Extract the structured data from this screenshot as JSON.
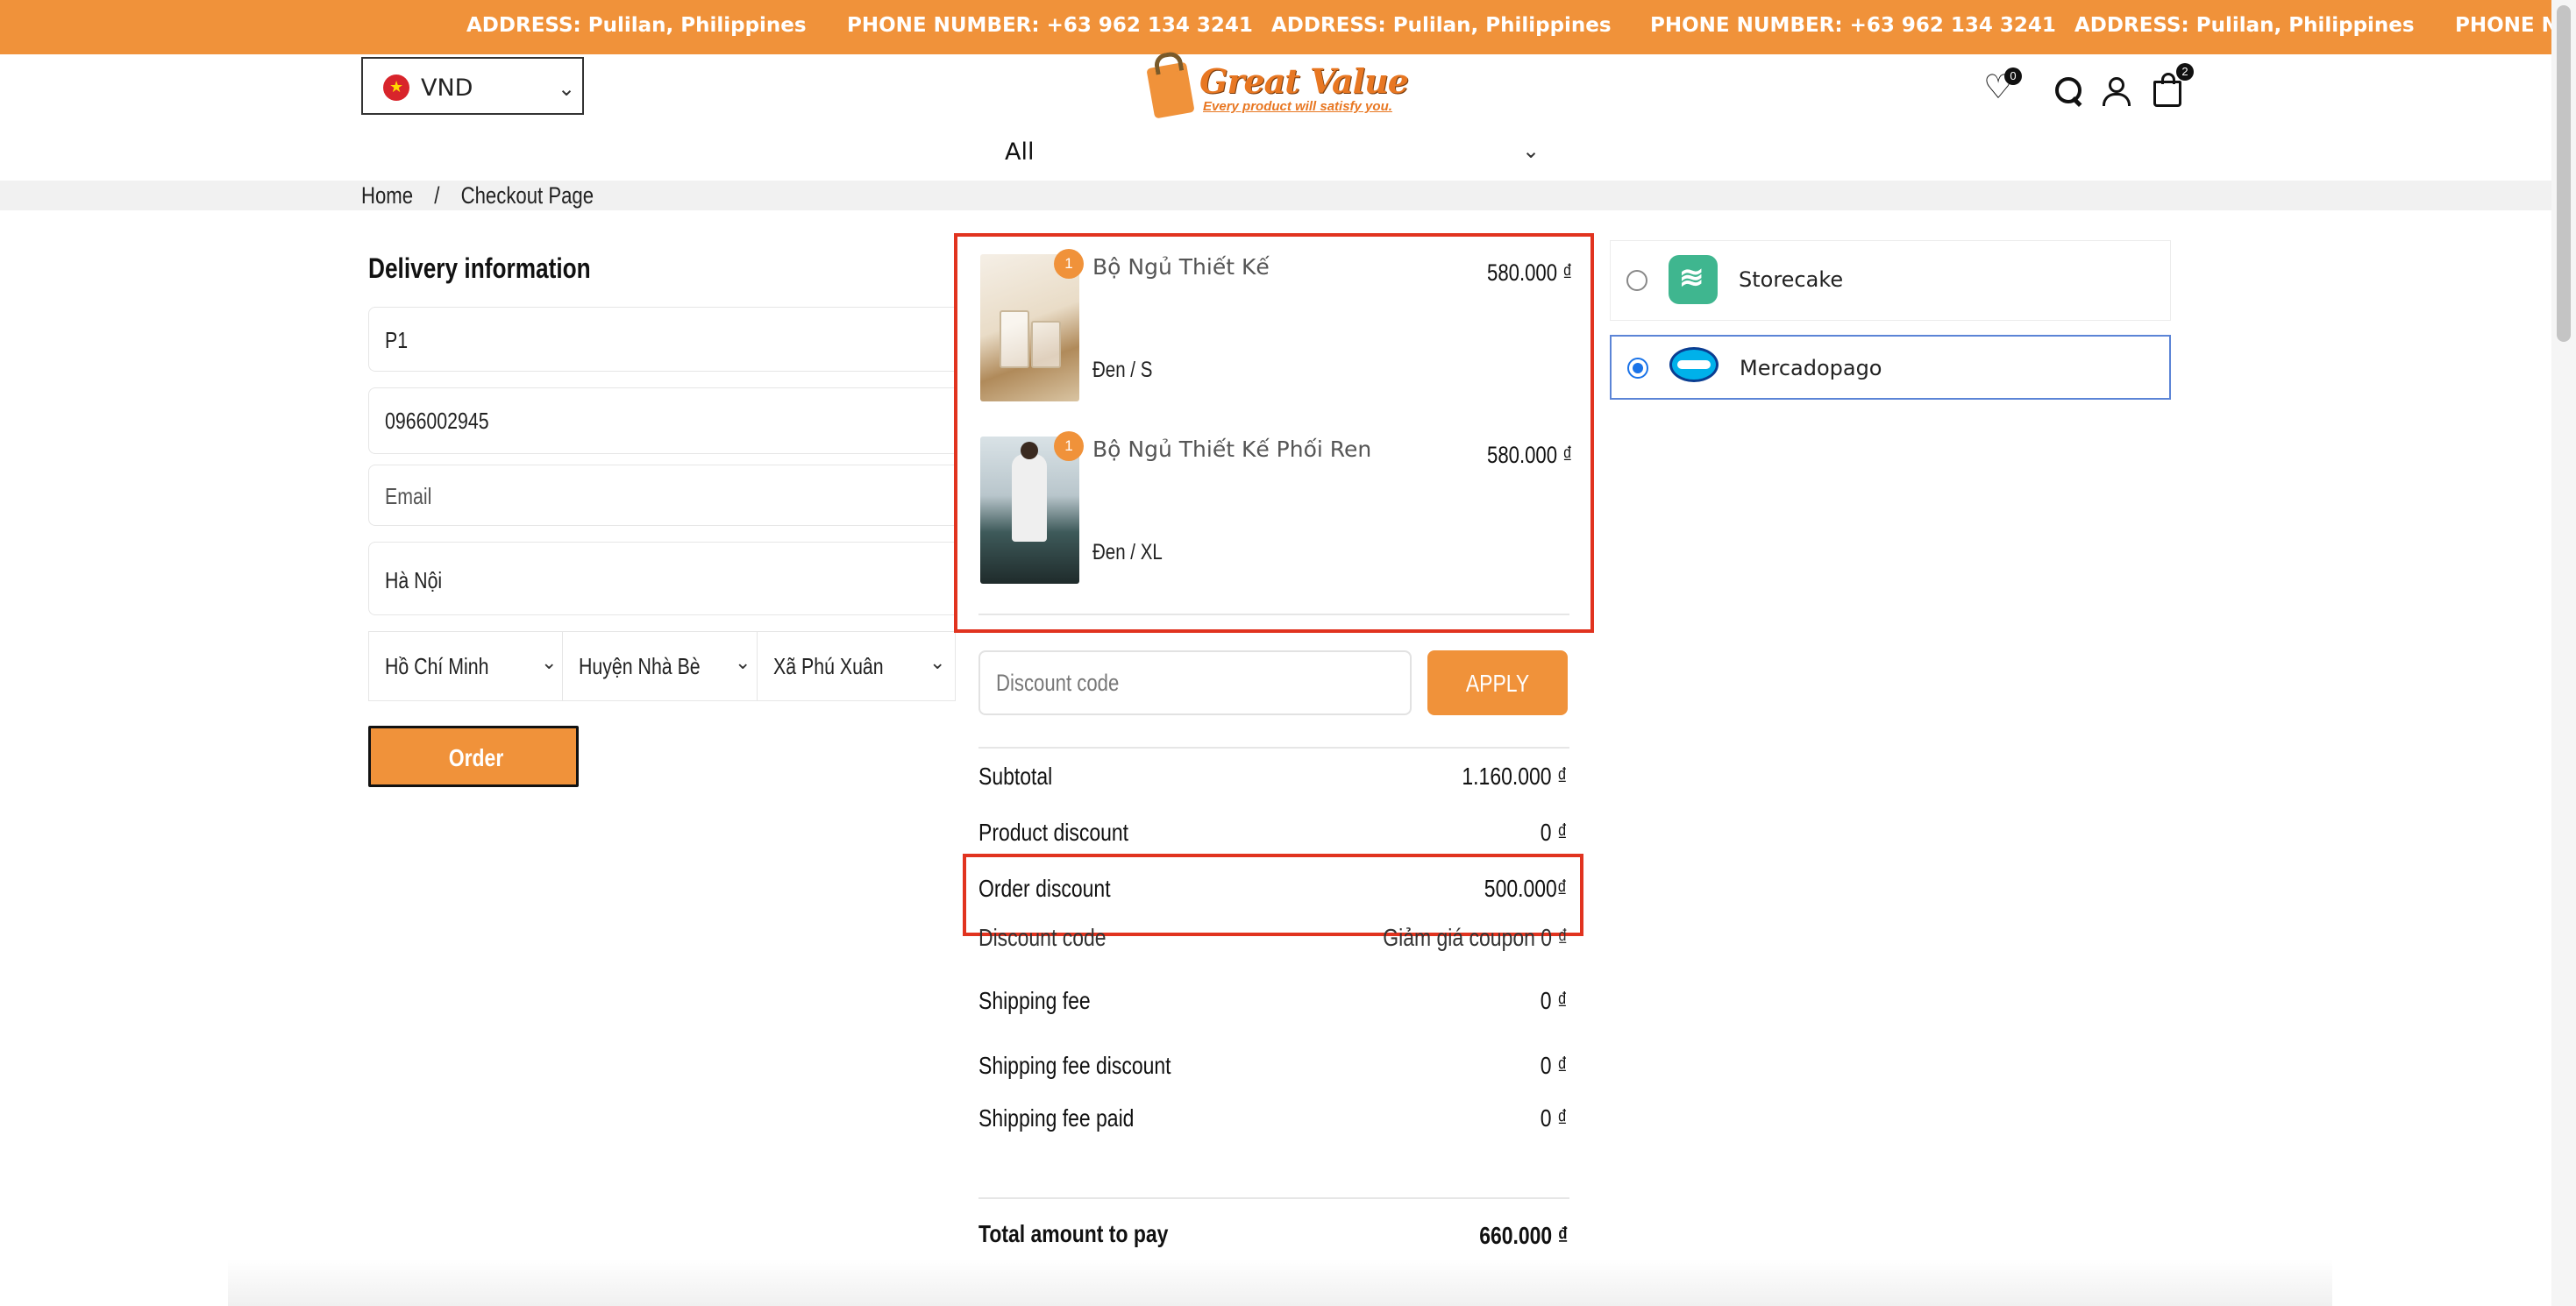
{
  "topbar": {
    "address": "ADDRESS: Pulilan, Philippines",
    "phone": "PHONE NUMBER: +63 962 134 3241",
    "phone_cut": "PHONE NU"
  },
  "header": {
    "currency": "VND",
    "logo_name": "Great Value",
    "logo_tagline": "Every product will satisfy you.",
    "wishlist_count": "0",
    "cart_count": "2",
    "category": "All"
  },
  "breadcrumb": {
    "home": "Home",
    "separator": "/",
    "current": "Checkout Page"
  },
  "delivery": {
    "title": "Delivery information",
    "name_value": "P1",
    "phone_value": "0966002945",
    "email_placeholder": "Email",
    "address_value": "Hà Nội",
    "province": "Hồ Chí Minh",
    "district": "Huyện Nhà Bè",
    "ward": "Xã Phú Xuân",
    "order_button": "Order"
  },
  "cart": {
    "items": [
      {
        "name": "Bộ Ngủ Thiết Kế",
        "variant": "Đen / S",
        "price": "580.000 ₫",
        "qty": "1"
      },
      {
        "name": "Bộ Ngủ Thiết Kế Phối Ren",
        "variant": "Đen / XL",
        "price": "580.000 ₫",
        "qty": "1"
      }
    ],
    "discount_placeholder": "Discount code",
    "apply_button": "APPLY"
  },
  "summary": {
    "subtotal_label": "Subtotal",
    "subtotal": "1.160.000 ₫",
    "product_discount_label": "Product discount",
    "product_discount": "0 ₫",
    "order_discount_label": "Order discount",
    "order_discount": "500.000₫",
    "discount_code_label": "Discount code",
    "discount_code": "Giảm giá coupon 0 ₫",
    "shipping_fee_label": "Shipping fee",
    "shipping_fee": "0 ₫",
    "shipping_fee_discount_label": "Shipping fee discount",
    "shipping_fee_discount": "0 ₫",
    "shipping_fee_paid_label": "Shipping fee paid",
    "shipping_fee_paid": "0 ₫",
    "total_label": "Total amount to pay",
    "total": "660.000 ₫"
  },
  "payment": {
    "options": [
      {
        "name": "Storecake",
        "selected": false
      },
      {
        "name": "Mercadopago",
        "selected": true
      }
    ]
  },
  "colors": {
    "accent": "#f0923a",
    "highlight": "#e1331f",
    "selected_border": "#5b84d6"
  }
}
